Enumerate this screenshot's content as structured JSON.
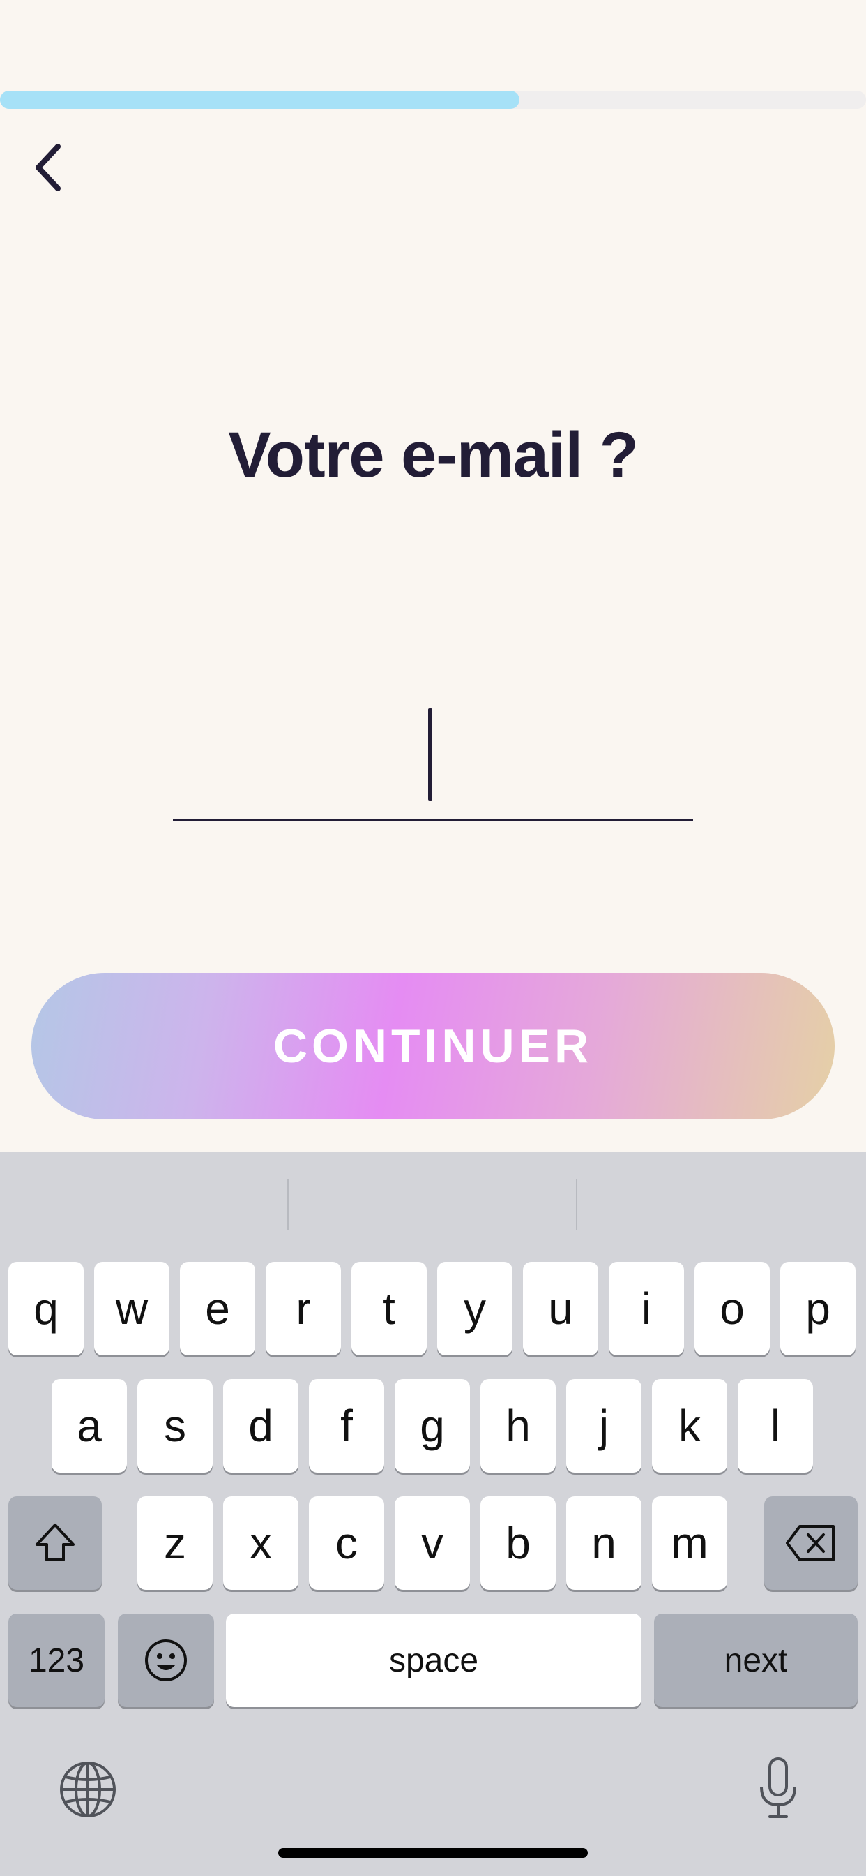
{
  "progress": {
    "fraction": 0.6,
    "color": "#A6E1F7"
  },
  "navigation": {
    "back_icon": "chevron-left-icon"
  },
  "page": {
    "title": "Votre e-mail ?"
  },
  "email": {
    "value": "",
    "placeholder": ""
  },
  "actions": {
    "continue_label": "CONTINUER"
  },
  "colors": {
    "background": "#FAF6F1",
    "text": "#221D36",
    "button_gradient": [
      "#B4C7E6",
      "#E58CF3",
      "#E5D0A6"
    ],
    "keyboard": "#D3D4D9"
  },
  "keyboard": {
    "row1": [
      "q",
      "w",
      "e",
      "r",
      "t",
      "y",
      "u",
      "i",
      "o",
      "p"
    ],
    "row2": [
      "a",
      "s",
      "d",
      "f",
      "g",
      "h",
      "j",
      "k",
      "l"
    ],
    "row3": [
      "z",
      "x",
      "c",
      "v",
      "b",
      "n",
      "m"
    ],
    "numbers_label": "123",
    "space_label": "space",
    "next_label": "next",
    "icons": {
      "shift": "shift-icon",
      "backspace": "backspace-icon",
      "emoji": "emoji-icon",
      "globe": "globe-icon",
      "microphone": "microphone-icon"
    }
  }
}
